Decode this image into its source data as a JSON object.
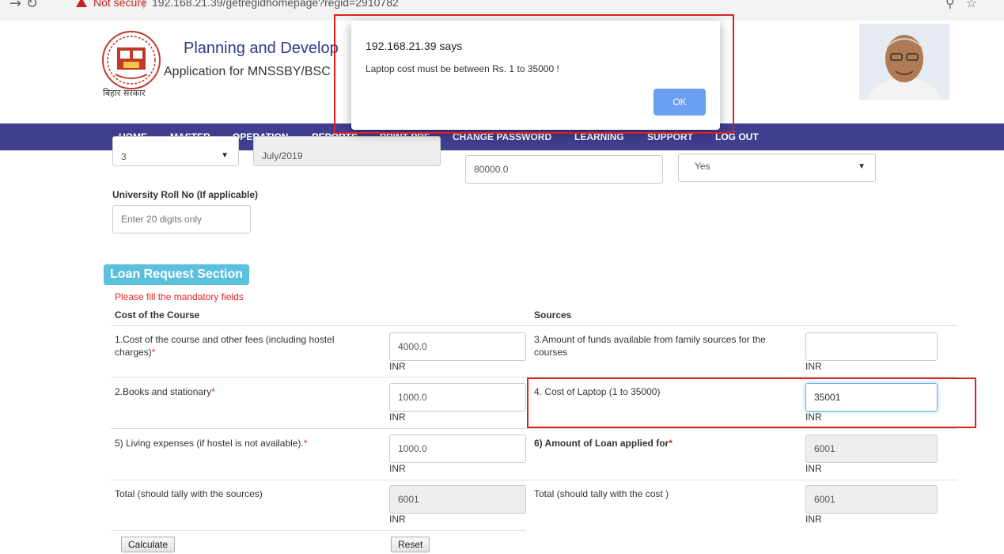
{
  "browser": {
    "security_label": "Not secure",
    "separator": "|",
    "url": "192.168.21.39/getregidhomepage?regid=2910782"
  },
  "header": {
    "emblem_caption": "बिहार सरकार",
    "title": "Planning and Develop",
    "subtitle": "Application for MNSSBY/BSC"
  },
  "nav": {
    "items": [
      "HOME",
      "MASTER",
      "OPERATION",
      "REPORTS",
      "PRINT PDF",
      "CHANGE PASSWORD",
      "LEARNING",
      "SUPPORT",
      "LOG OUT"
    ]
  },
  "top_form": {
    "semester_value": "3",
    "month_value": "July/2019",
    "income_value": "80000.0",
    "yes_no_value": "Yes",
    "roll_no_label": "University Roll No (If applicable)",
    "roll_no_placeholder": "Enter 20 digits only"
  },
  "loan": {
    "section_title": "Loan Request Section",
    "mandatory_note": "Please fill the mandatory fields",
    "cost_header": "Cost of the Course",
    "sources_header": "Sources",
    "currency": "INR",
    "rows": [
      {
        "label": "1.Cost of the course and other fees (including hostel charges)",
        "value": "4000.0",
        "required": "*"
      },
      {
        "label": "2.Books and stationary",
        "value": "1000.0",
        "required": "*"
      },
      {
        "label": "5) Living expenses (if hostel is not available).",
        "value": "1000.0",
        "required": "*"
      },
      {
        "label": "Total (should tally with the sources)",
        "value": "6001",
        "required": ""
      }
    ],
    "sources": [
      {
        "label": "3.Amount of funds available from family sources for the courses",
        "value": "",
        "required": ""
      },
      {
        "label": "4. Cost of Laptop (1 to 35000)",
        "value": "35001",
        "required": ""
      },
      {
        "label": "6) Amount of Loan applied for",
        "value": "6001",
        "required": "*"
      },
      {
        "label": "Total (should tally with the cost )",
        "value": "6001",
        "required": ""
      }
    ],
    "calculate_label": "Calculate",
    "reset_label": "Reset"
  },
  "dialog": {
    "title": "192.168.21.39 says",
    "message": "Laptop cost must be between Rs. 1 to 35000 !",
    "ok_label": "OK"
  },
  "colors": {
    "nav_bg": "#3f3e8f",
    "badge_bg": "#5bc0de",
    "highlight": "#e02020",
    "ok_button": "#6c9ff2"
  }
}
